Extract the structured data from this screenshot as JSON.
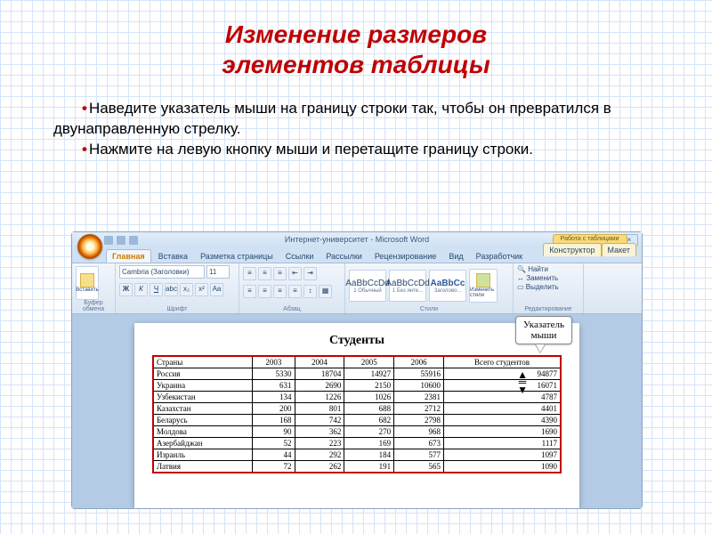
{
  "title_line1": "Изменение размеров",
  "title_line2": "элементов таблицы",
  "bullet1": "Наведите указатель мыши на границу строки так, чтобы он превратился в двунаправленную стрелку.",
  "bullet2": "Нажмите на левую кнопку мыши и перетащите границу строки.",
  "word": {
    "title": "Интернет-университет - Microsoft Word",
    "context_header": "Работа с таблицами",
    "tabs": [
      "Главная",
      "Вставка",
      "Разметка страницы",
      "Ссылки",
      "Рассылки",
      "Рецензирование",
      "Вид",
      "Разработчик"
    ],
    "context_tabs": [
      "Конструктор",
      "Макет"
    ],
    "font_name": "Cambria (Заголовки)",
    "font_size": "11",
    "groups": {
      "clipboard": "Буфер обмена",
      "font": "Шрифт",
      "para": "Абзац",
      "styles": "Стили",
      "edit": "Редактирование"
    },
    "paste_label": "Вставить",
    "styles_list": [
      {
        "aa": "AaBbCcDd",
        "lbl": "1 Обычный"
      },
      {
        "aa": "AaBbCcDd",
        "lbl": "1 Без инте..."
      },
      {
        "aa": "AaBbCc",
        "lbl": "Заголово..."
      }
    ],
    "change_styles": "Изменить стили",
    "find": "Найти",
    "replace": "Заменить",
    "select": "Выделить"
  },
  "callout_line1": "Указатель",
  "callout_line2": "мыши",
  "doc": {
    "title": "Студенты",
    "headers": [
      "Страны",
      "2003",
      "2004",
      "2005",
      "2006",
      "Всего студентов"
    ],
    "rows": [
      [
        "Россия",
        "5330",
        "18704",
        "14927",
        "55916",
        "94877"
      ],
      [
        "Украина",
        "631",
        "2690",
        "2150",
        "10600",
        "16071"
      ],
      [
        "Узбекистан",
        "134",
        "1226",
        "1026",
        "2381",
        "4787"
      ],
      [
        "Казахстан",
        "200",
        "801",
        "688",
        "2712",
        "4401"
      ],
      [
        "Беларусь",
        "168",
        "742",
        "682",
        "2798",
        "4390"
      ],
      [
        "Молдова",
        "90",
        "362",
        "270",
        "968",
        "1690"
      ],
      [
        "Азербайджан",
        "52",
        "223",
        "169",
        "673",
        "1117"
      ],
      [
        "Израиль",
        "44",
        "292",
        "184",
        "577",
        "1097"
      ],
      [
        "Латвия",
        "72",
        "262",
        "191",
        "565",
        "1090"
      ]
    ]
  }
}
